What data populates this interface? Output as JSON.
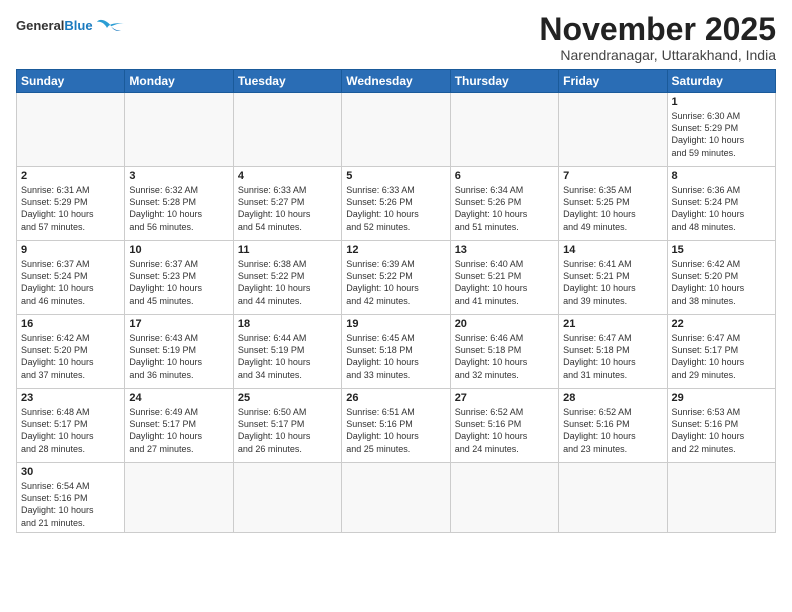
{
  "header": {
    "logo_general": "General",
    "logo_blue": "Blue",
    "month_year": "November 2025",
    "location": "Narendranagar, Uttarakhand, India"
  },
  "days_of_week": [
    "Sunday",
    "Monday",
    "Tuesday",
    "Wednesday",
    "Thursday",
    "Friday",
    "Saturday"
  ],
  "weeks": [
    [
      {
        "num": "",
        "info": ""
      },
      {
        "num": "",
        "info": ""
      },
      {
        "num": "",
        "info": ""
      },
      {
        "num": "",
        "info": ""
      },
      {
        "num": "",
        "info": ""
      },
      {
        "num": "",
        "info": ""
      },
      {
        "num": "1",
        "info": "Sunrise: 6:30 AM\nSunset: 5:29 PM\nDaylight: 10 hours\nand 59 minutes."
      }
    ],
    [
      {
        "num": "2",
        "info": "Sunrise: 6:31 AM\nSunset: 5:29 PM\nDaylight: 10 hours\nand 57 minutes."
      },
      {
        "num": "3",
        "info": "Sunrise: 6:32 AM\nSunset: 5:28 PM\nDaylight: 10 hours\nand 56 minutes."
      },
      {
        "num": "4",
        "info": "Sunrise: 6:33 AM\nSunset: 5:27 PM\nDaylight: 10 hours\nand 54 minutes."
      },
      {
        "num": "5",
        "info": "Sunrise: 6:33 AM\nSunset: 5:26 PM\nDaylight: 10 hours\nand 52 minutes."
      },
      {
        "num": "6",
        "info": "Sunrise: 6:34 AM\nSunset: 5:26 PM\nDaylight: 10 hours\nand 51 minutes."
      },
      {
        "num": "7",
        "info": "Sunrise: 6:35 AM\nSunset: 5:25 PM\nDaylight: 10 hours\nand 49 minutes."
      },
      {
        "num": "8",
        "info": "Sunrise: 6:36 AM\nSunset: 5:24 PM\nDaylight: 10 hours\nand 48 minutes."
      }
    ],
    [
      {
        "num": "9",
        "info": "Sunrise: 6:37 AM\nSunset: 5:24 PM\nDaylight: 10 hours\nand 46 minutes."
      },
      {
        "num": "10",
        "info": "Sunrise: 6:37 AM\nSunset: 5:23 PM\nDaylight: 10 hours\nand 45 minutes."
      },
      {
        "num": "11",
        "info": "Sunrise: 6:38 AM\nSunset: 5:22 PM\nDaylight: 10 hours\nand 44 minutes."
      },
      {
        "num": "12",
        "info": "Sunrise: 6:39 AM\nSunset: 5:22 PM\nDaylight: 10 hours\nand 42 minutes."
      },
      {
        "num": "13",
        "info": "Sunrise: 6:40 AM\nSunset: 5:21 PM\nDaylight: 10 hours\nand 41 minutes."
      },
      {
        "num": "14",
        "info": "Sunrise: 6:41 AM\nSunset: 5:21 PM\nDaylight: 10 hours\nand 39 minutes."
      },
      {
        "num": "15",
        "info": "Sunrise: 6:42 AM\nSunset: 5:20 PM\nDaylight: 10 hours\nand 38 minutes."
      }
    ],
    [
      {
        "num": "16",
        "info": "Sunrise: 6:42 AM\nSunset: 5:20 PM\nDaylight: 10 hours\nand 37 minutes."
      },
      {
        "num": "17",
        "info": "Sunrise: 6:43 AM\nSunset: 5:19 PM\nDaylight: 10 hours\nand 36 minutes."
      },
      {
        "num": "18",
        "info": "Sunrise: 6:44 AM\nSunset: 5:19 PM\nDaylight: 10 hours\nand 34 minutes."
      },
      {
        "num": "19",
        "info": "Sunrise: 6:45 AM\nSunset: 5:18 PM\nDaylight: 10 hours\nand 33 minutes."
      },
      {
        "num": "20",
        "info": "Sunrise: 6:46 AM\nSunset: 5:18 PM\nDaylight: 10 hours\nand 32 minutes."
      },
      {
        "num": "21",
        "info": "Sunrise: 6:47 AM\nSunset: 5:18 PM\nDaylight: 10 hours\nand 31 minutes."
      },
      {
        "num": "22",
        "info": "Sunrise: 6:47 AM\nSunset: 5:17 PM\nDaylight: 10 hours\nand 29 minutes."
      }
    ],
    [
      {
        "num": "23",
        "info": "Sunrise: 6:48 AM\nSunset: 5:17 PM\nDaylight: 10 hours\nand 28 minutes."
      },
      {
        "num": "24",
        "info": "Sunrise: 6:49 AM\nSunset: 5:17 PM\nDaylight: 10 hours\nand 27 minutes."
      },
      {
        "num": "25",
        "info": "Sunrise: 6:50 AM\nSunset: 5:17 PM\nDaylight: 10 hours\nand 26 minutes."
      },
      {
        "num": "26",
        "info": "Sunrise: 6:51 AM\nSunset: 5:16 PM\nDaylight: 10 hours\nand 25 minutes."
      },
      {
        "num": "27",
        "info": "Sunrise: 6:52 AM\nSunset: 5:16 PM\nDaylight: 10 hours\nand 24 minutes."
      },
      {
        "num": "28",
        "info": "Sunrise: 6:52 AM\nSunset: 5:16 PM\nDaylight: 10 hours\nand 23 minutes."
      },
      {
        "num": "29",
        "info": "Sunrise: 6:53 AM\nSunset: 5:16 PM\nDaylight: 10 hours\nand 22 minutes."
      }
    ],
    [
      {
        "num": "30",
        "info": "Sunrise: 6:54 AM\nSunset: 5:16 PM\nDaylight: 10 hours\nand 21 minutes."
      },
      {
        "num": "",
        "info": ""
      },
      {
        "num": "",
        "info": ""
      },
      {
        "num": "",
        "info": ""
      },
      {
        "num": "",
        "info": ""
      },
      {
        "num": "",
        "info": ""
      },
      {
        "num": "",
        "info": ""
      }
    ]
  ]
}
